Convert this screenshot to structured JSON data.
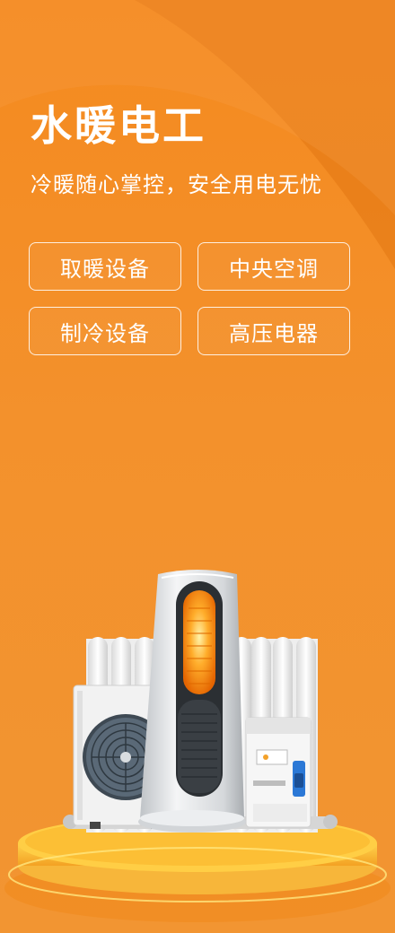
{
  "header": {
    "title": "水暖电工",
    "subtitle": "冷暖随心掌控，安全用电无忧"
  },
  "categories": [
    {
      "label": "取暖设备"
    },
    {
      "label": "中央空调"
    },
    {
      "label": "制冷设备"
    },
    {
      "label": "高压电器"
    }
  ],
  "colors": {
    "background": "#f58a1f",
    "heater_glow": "#ff8a00"
  },
  "icons": [
    "air-conditioner-outdoor-unit-icon",
    "tower-heater-icon",
    "radiator-icon",
    "circuit-breaker-icon"
  ]
}
